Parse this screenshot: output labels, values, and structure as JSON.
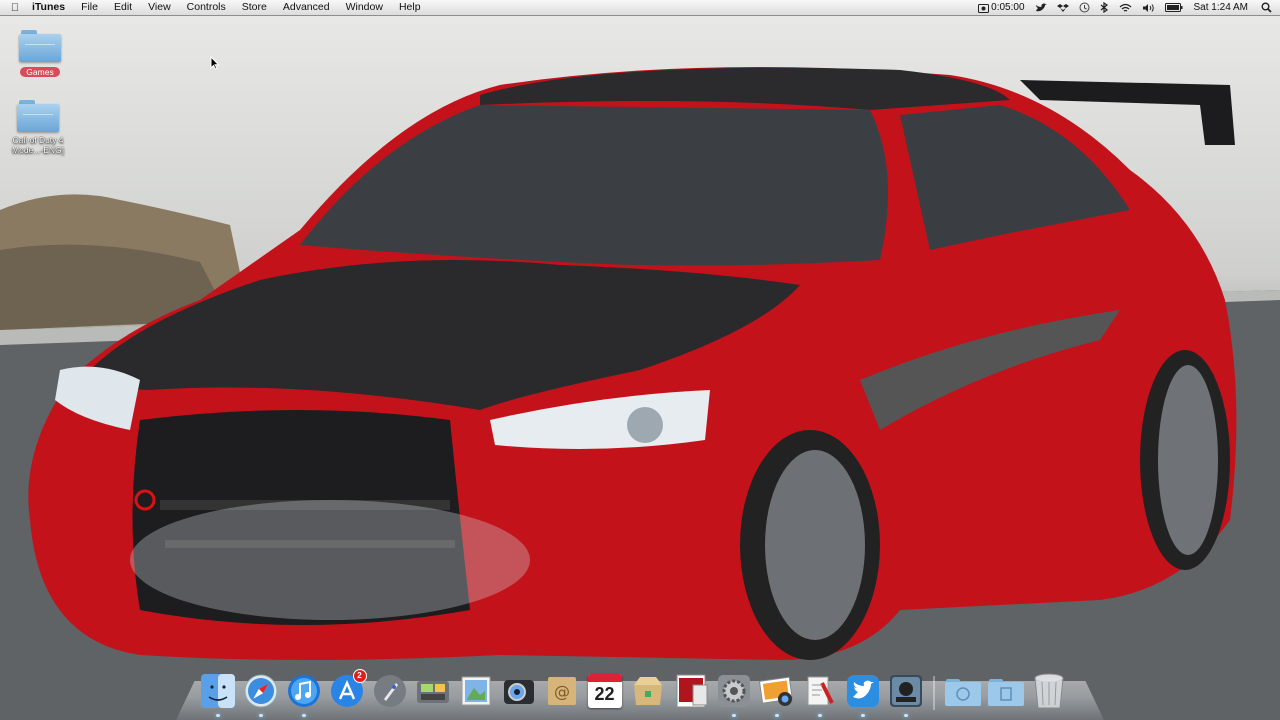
{
  "menubar": {
    "app_name": "iTunes",
    "menus": [
      "File",
      "Edit",
      "View",
      "Controls",
      "Store",
      "Advanced",
      "Window",
      "Help"
    ],
    "status": {
      "timer": "0:05:00",
      "clock": "Sat 1:24 AM"
    }
  },
  "desktop": {
    "icons": [
      {
        "label": "Games",
        "selected": true
      },
      {
        "label": "Call of Duty 4\nMode...-ENG]",
        "selected": false
      }
    ]
  },
  "dock": {
    "calendar_day": "22",
    "app_store_badge": "2",
    "items": [
      "finder-icon",
      "safari-icon",
      "itunes-icon",
      "app-store-icon",
      "launchpad-icon",
      "image-capture-icon",
      "preview-icon",
      "photo-booth-icon",
      "mail-icon",
      "ical-icon",
      "archive-utility-icon",
      "photo-stack-icon",
      "system-preferences-icon",
      "iphoto-icon",
      "script-editor-icon",
      "twitter-icon",
      "game-icon",
      "applications-folder-icon",
      "documents-folder-icon",
      "trash-icon"
    ]
  }
}
